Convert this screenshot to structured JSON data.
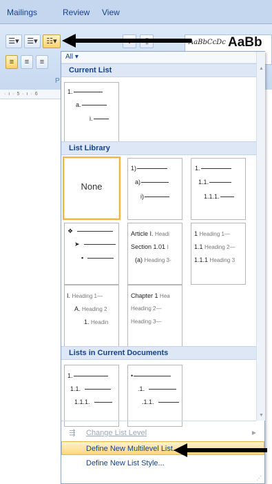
{
  "ribbon": {
    "tabs": [
      {
        "label": "Mailings"
      },
      {
        "label": "Review"
      },
      {
        "label": "View"
      }
    ],
    "group_label": "P",
    "ruler_text": "· ı · 5 · ı · 6",
    "styles_sample_small": "AaBbCcDc",
    "styles_sample_large": "AaBb",
    "buttons": {
      "bullets": "☰▾",
      "numbering": "☰▾",
      "multilevel": "☷▾",
      "sort": "↕",
      "show_marks": "¶",
      "align_left": "≡",
      "center": "≡",
      "align_right": "≡"
    }
  },
  "dropdown": {
    "filter_label": "All ▾",
    "sections": {
      "current_list": "Current List",
      "list_library": "List Library",
      "lists_in_current_documents": "Lists in Current Documents"
    },
    "current_list": {
      "lines": [
        "1.",
        "a.",
        "i."
      ]
    },
    "library": {
      "none_label": "None",
      "parens": [
        "1)",
        "a)",
        "i)"
      ],
      "decimal": [
        "1.",
        "1.1.",
        "1.1.1."
      ],
      "bullets": [
        "❖",
        "➤",
        "▪"
      ],
      "article": [
        "Article I.",
        "Headi",
        "Section 1.01",
        "I",
        "(a)",
        "Heading 3-"
      ],
      "heading_numbered": [
        "1",
        "Heading 1—",
        "1.1",
        "Heading 2—",
        "1.1.1",
        "Heading 3"
      ],
      "roman": [
        "I.",
        "Heading 1—",
        "A.",
        "Heading 2",
        "1.",
        "Headin"
      ],
      "chapter": [
        "Chapter 1",
        "Hea",
        "Heading 2—",
        "Heading 3—"
      ]
    },
    "current_docs": {
      "decimal": [
        "1.",
        "1.1.",
        "1.1.1."
      ],
      "bullet": [
        "•",
        ".1.",
        ".1.1."
      ]
    },
    "menu": {
      "change_level": "Change List Level",
      "define_multilevel": "Define New Multilevel List...",
      "define_style": "Define New List Style..."
    }
  }
}
